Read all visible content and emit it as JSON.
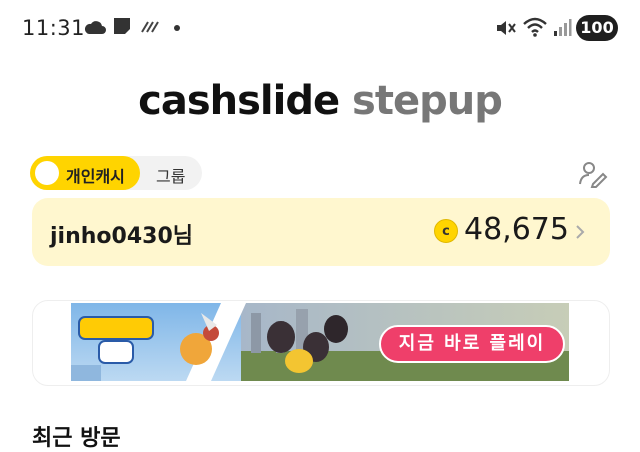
{
  "status_bar": {
    "time": "11:31",
    "battery": "100",
    "icons": [
      "cloud-icon",
      "doc-icon",
      "slash-icon",
      "dot-icon",
      "mute-icon",
      "wifi-icon",
      "signal-icon"
    ]
  },
  "header": {
    "brand": "cashslide",
    "sub": "stepup"
  },
  "mode_toggle": {
    "active_label": "개인캐시",
    "inactive_label": "그룹",
    "accent_color": "#ffd400"
  },
  "account": {
    "name": "jinho0430님",
    "coin_symbol": "c",
    "points": "48,675",
    "card_color": "#fff7cf"
  },
  "ad": {
    "cta_label": "지금 바로 플레이",
    "cta_color": "#ef3f6a"
  },
  "section": {
    "title": "최근 방문"
  }
}
